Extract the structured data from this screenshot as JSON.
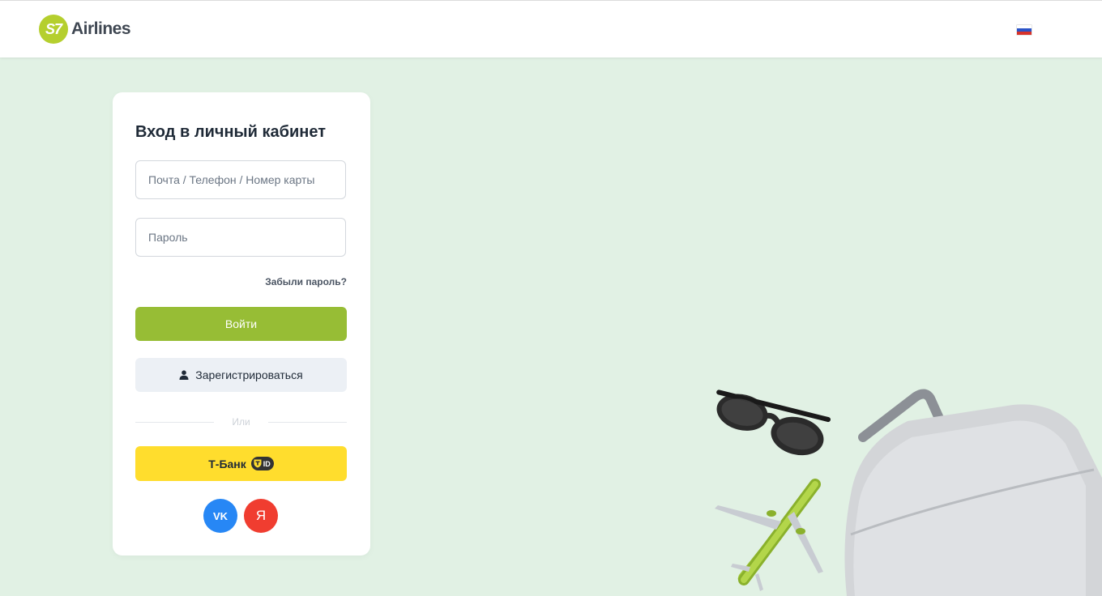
{
  "header": {
    "logo_badge": "S7",
    "logo_text": "Airlines",
    "language_flag": "ru-flag-icon"
  },
  "login": {
    "title": "Вход в личный кабинет",
    "login_placeholder": "Почта / Телефон / Номер карты",
    "password_placeholder": "Пароль",
    "forgot_password": "Забыли пароль?",
    "login_button": "Войти",
    "register_button": "Зарегистрироваться",
    "divider_text": "Или",
    "tbank_button": "Т-Банк",
    "tbank_badge": "ID",
    "vk_label": "VK",
    "yandex_label": "Я"
  },
  "colors": {
    "background": "#e1f1e4",
    "primary": "#97bd35",
    "tbank": "#ffdd2d",
    "vk": "#2787f5",
    "yandex": "#f03d30"
  }
}
